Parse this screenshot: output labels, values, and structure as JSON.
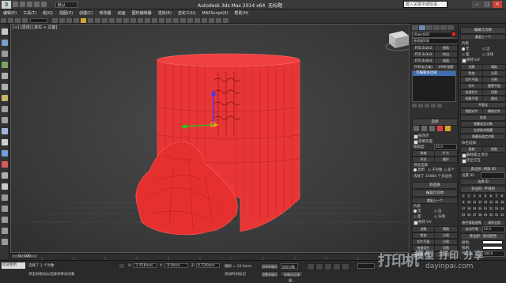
{
  "app": {
    "title": "Autodesk 3ds Max 2014 x64",
    "file": "无标题",
    "search_placeholder": "键入关键字或短语",
    "workspace": "默认",
    "menu": [
      "编辑(E)",
      "工具(T)",
      "组(G)",
      "视图(V)",
      "创建(C)",
      "修改器",
      "动画",
      "图形编辑器",
      "渲染(R)",
      "自定义(U)",
      "MAXScript(X)",
      "帮助(H)"
    ]
  },
  "viewport": {
    "label": "[+] [透视] [真实 + 边面]",
    "background": "#3c3c3c",
    "mesh_color": "#ff2a2a"
  },
  "command_panel": {
    "object_name": "Object001",
    "color_swatch": "#ff2020",
    "modifier_list": "修改器列表",
    "buttons": [
      "FFD 2x2x2",
      "倒角",
      "FFD 3x3x3",
      "挤出",
      "FFD 4x4x4",
      "曲面",
      "FFD(长方体)",
      "UVW 贴图"
    ],
    "stack_item": "可编辑多边形",
    "selection_section": "选择",
    "by_vertex": "按顶点",
    "ignore_backfacing": "忽略背面",
    "by_angle_label": "按角度:",
    "by_angle_value": "45.0",
    "shrink": "收缩",
    "grow": "扩大",
    "ring": "环形",
    "loop": "循环",
    "preview_selection": "预览选择",
    "off": "禁用",
    "subobj": "子对象",
    "multi": "多个",
    "selected_count": "选择了 31684 个多边形",
    "soft_selection": "软选择",
    "edit_geometry": "编辑几何体",
    "repeat_last": "重复上一个",
    "constraints": "约束",
    "none": "无",
    "edge": "边",
    "face": "面",
    "normal": "法线",
    "preserve_uvs": "保持 UV",
    "create": "创建",
    "collapse": "塌陷",
    "attach": "附加",
    "detach": "分离",
    "slice_plane": "切片平面",
    "split": "分割",
    "slice": "切片",
    "reset_plane": "重置平面",
    "quickslice": "快速切片",
    "cut": "切割",
    "msmooth": "网格平滑",
    "tessellate": "细化",
    "make_planar": "平面化",
    "view_align": "视图对齐",
    "grid_align": "栅格对齐",
    "relax": "松弛",
    "hide_selected": "隐藏选定对象",
    "unhide_all": "全部取消隐藏",
    "hide_unselected": "隐藏未选定对象",
    "named_selections": "命名选择:",
    "copy": "复制",
    "paste": "粘贴",
    "delete_isolated": "删除孤立顶点",
    "full_interactivity": "完全交互"
  },
  "side_panel": {
    "edit_polygons": "编辑多边形",
    "insert_vertex": "插入顶点",
    "extrude": "挤出",
    "outline": "轮廓",
    "bevel": "倒角",
    "inset": "插入",
    "bridge": "桥",
    "flip": "翻转",
    "hinge_from_edge": "从边旋转",
    "extrude_along_spline": "沿样条线挤出",
    "edit_triangulation": "编辑三角剖分",
    "retriangulate": "重复三角算法",
    "turn": "旋转",
    "polygon_material_ids": "多边形: 材质 ID",
    "set_id": "设置 ID:",
    "select_id": "选择 ID",
    "clear_selection": "清除选定内容",
    "smoothing_groups": "多边形: 平滑组",
    "select_by_sg": "按平滑组选择",
    "clear_all": "清除全部",
    "auto_smooth": "自动平滑",
    "auto_smooth_value": "45.0",
    "vertex_colors": "多边形: 顶点颜色",
    "color": "颜色:",
    "illumination": "照明:",
    "alpha": "Alpha:",
    "alpha_value": "100.0",
    "sg_numbers": [
      "1",
      "2",
      "3",
      "4",
      "5",
      "6",
      "7",
      "8",
      "9",
      "10",
      "11",
      "12",
      "13",
      "14",
      "15",
      "16",
      "17",
      "18",
      "19",
      "20",
      "21",
      "22",
      "23",
      "24",
      "25",
      "26",
      "27",
      "28",
      "29",
      "30",
      "31",
      "32"
    ]
  },
  "timeline": {
    "frame": "0 / 100"
  },
  "status": {
    "selected": "选择了 1 个对象",
    "prompt": "单击并拖动以选择并移动对象",
    "welcome": "欢迎使用 MAXScr",
    "x_label": "X:",
    "x_value": "-1.556mm",
    "y_label": "Y:",
    "y_value": "-0.0mm",
    "z_label": "Z:",
    "z_value": "0.726mm",
    "grid": "栅格 = 10.0mm",
    "add_time_tag": "添加时间标记",
    "auto_key": "自动关键点",
    "set_key": "设置关键点",
    "key_filters": "关键点过滤器...",
    "selected_obj": "选定对象"
  },
  "watermark": {
    "brand": "打印机",
    "cn": "模型 打印 分享",
    "url": "dayinpai.com"
  }
}
